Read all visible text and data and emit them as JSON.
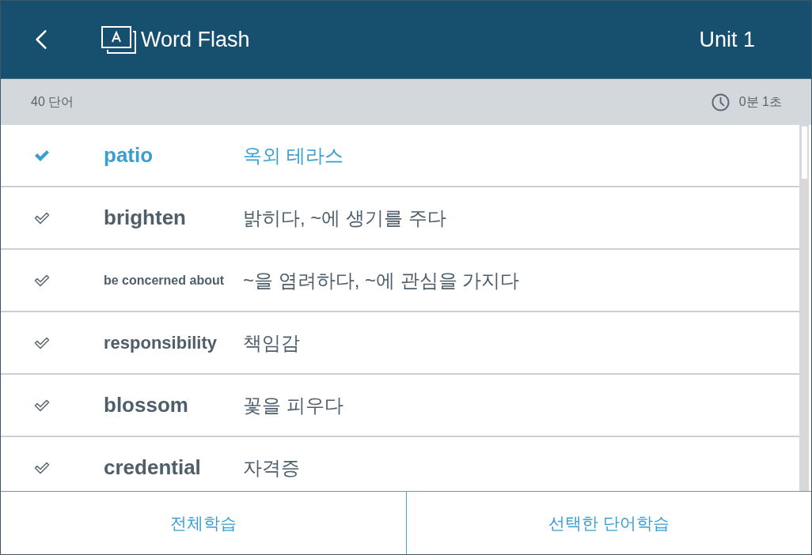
{
  "header": {
    "title": "Word Flash",
    "unit": "Unit 1"
  },
  "summary": {
    "word_count": "40 단어",
    "elapsed": "0분 1초"
  },
  "words": [
    {
      "word": "patio",
      "meaning": "옥외 테라스",
      "selected": true
    },
    {
      "word": "brighten",
      "meaning": "밝히다, ~에 생기를 주다",
      "selected": false
    },
    {
      "word": "be concerned about",
      "meaning": "~을 염려하다, ~에 관심을 가지다",
      "selected": false
    },
    {
      "word": "responsibility",
      "meaning": "책임감",
      "selected": false
    },
    {
      "word": "blossom",
      "meaning": "꽃을 피우다",
      "selected": false
    },
    {
      "word": "credential",
      "meaning": "자격증",
      "selected": false
    }
  ],
  "buttons": [
    {
      "label": "전체학습"
    },
    {
      "label": "선택한 단어학습"
    }
  ]
}
